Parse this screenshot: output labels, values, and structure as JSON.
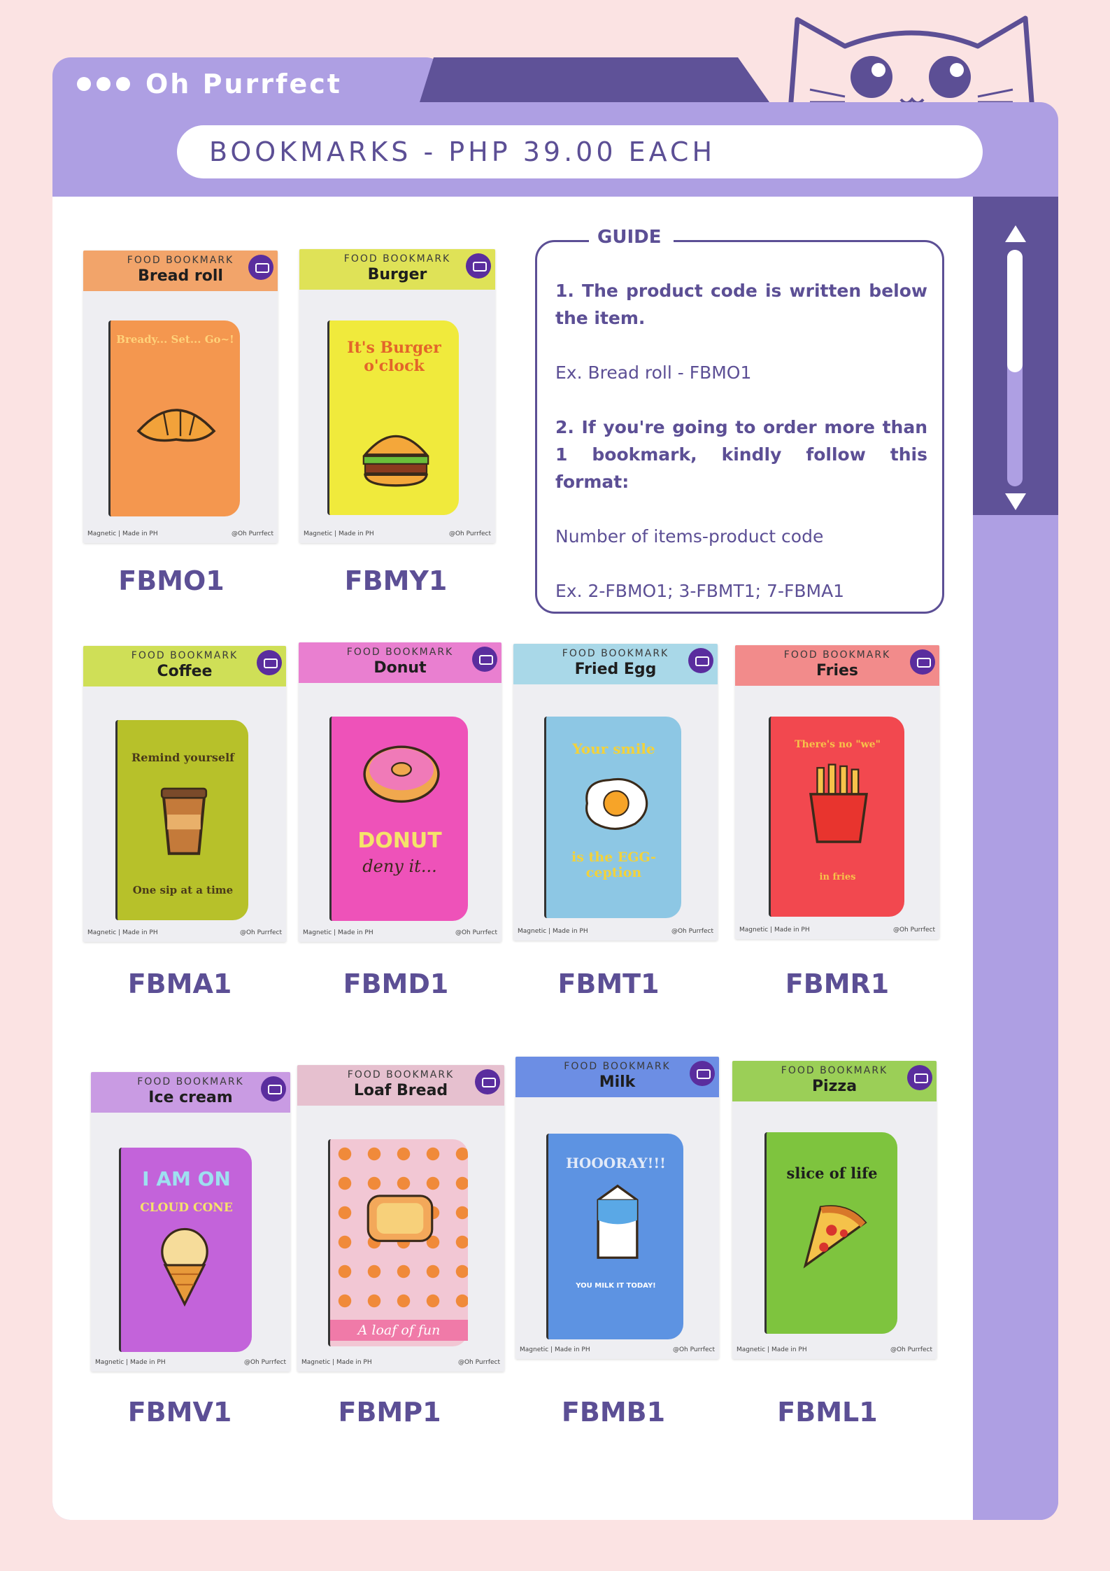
{
  "brand": {
    "name": "Oh Purrfect"
  },
  "header": {
    "title": "BOOKMARKS - PHP 39.00 EACH"
  },
  "guide": {
    "title": "GUIDE",
    "step1": "1. The product code is written below the item.",
    "example1": "Ex. Bread roll - FBMO1",
    "step2": "2. If you're going to order more than 1 bookmark, kindly follow this format:",
    "format": "Number of items-product code",
    "example2": "Ex. 2-FBMO1; 3-FBMT1; 7-FBMA1"
  },
  "card_common": {
    "kicker": "FOOD BOOKMARK",
    "foot_left": "Magnetic  |  Made in PH",
    "foot_right": "@Oh Purrfect"
  },
  "products": [
    {
      "name": "Bread roll",
      "code": "FBMO1",
      "text": "Bready... Set... Go~!",
      "sub": ""
    },
    {
      "name": "Burger",
      "code": "FBMY1",
      "text": "It's Burger o'clock",
      "sub": ""
    },
    {
      "name": "Coffee",
      "code": "FBMA1",
      "text": "Remind yourself",
      "sub": "One sip at a time"
    },
    {
      "name": "Donut",
      "code": "FBMD1",
      "text": "DONUT",
      "sub": "deny it..."
    },
    {
      "name": "Fried Egg",
      "code": "FBMT1",
      "text": "Your smile",
      "sub": "is the EGG-ception"
    },
    {
      "name": "Fries",
      "code": "FBMR1",
      "text": "There's no \"we\"",
      "sub": "in fries"
    },
    {
      "name": "Ice cream",
      "code": "FBMV1",
      "text": "I AM ON",
      "sub": "CLOUD CONE"
    },
    {
      "name": "Loaf Bread",
      "code": "FBMP1",
      "text": "",
      "sub": "A loaf of fun"
    },
    {
      "name": "Milk",
      "code": "FBMB1",
      "text": "HOOORAY!!!",
      "sub": "YOU MILK IT TODAY!"
    },
    {
      "name": "Pizza",
      "code": "FBML1",
      "text": "slice of life",
      "sub": ""
    }
  ],
  "colors": {
    "frame": "#ae9fe3",
    "frame_dark": "#5f5298",
    "text_primary": "#5c4f95",
    "background": "#fbe3e3"
  }
}
